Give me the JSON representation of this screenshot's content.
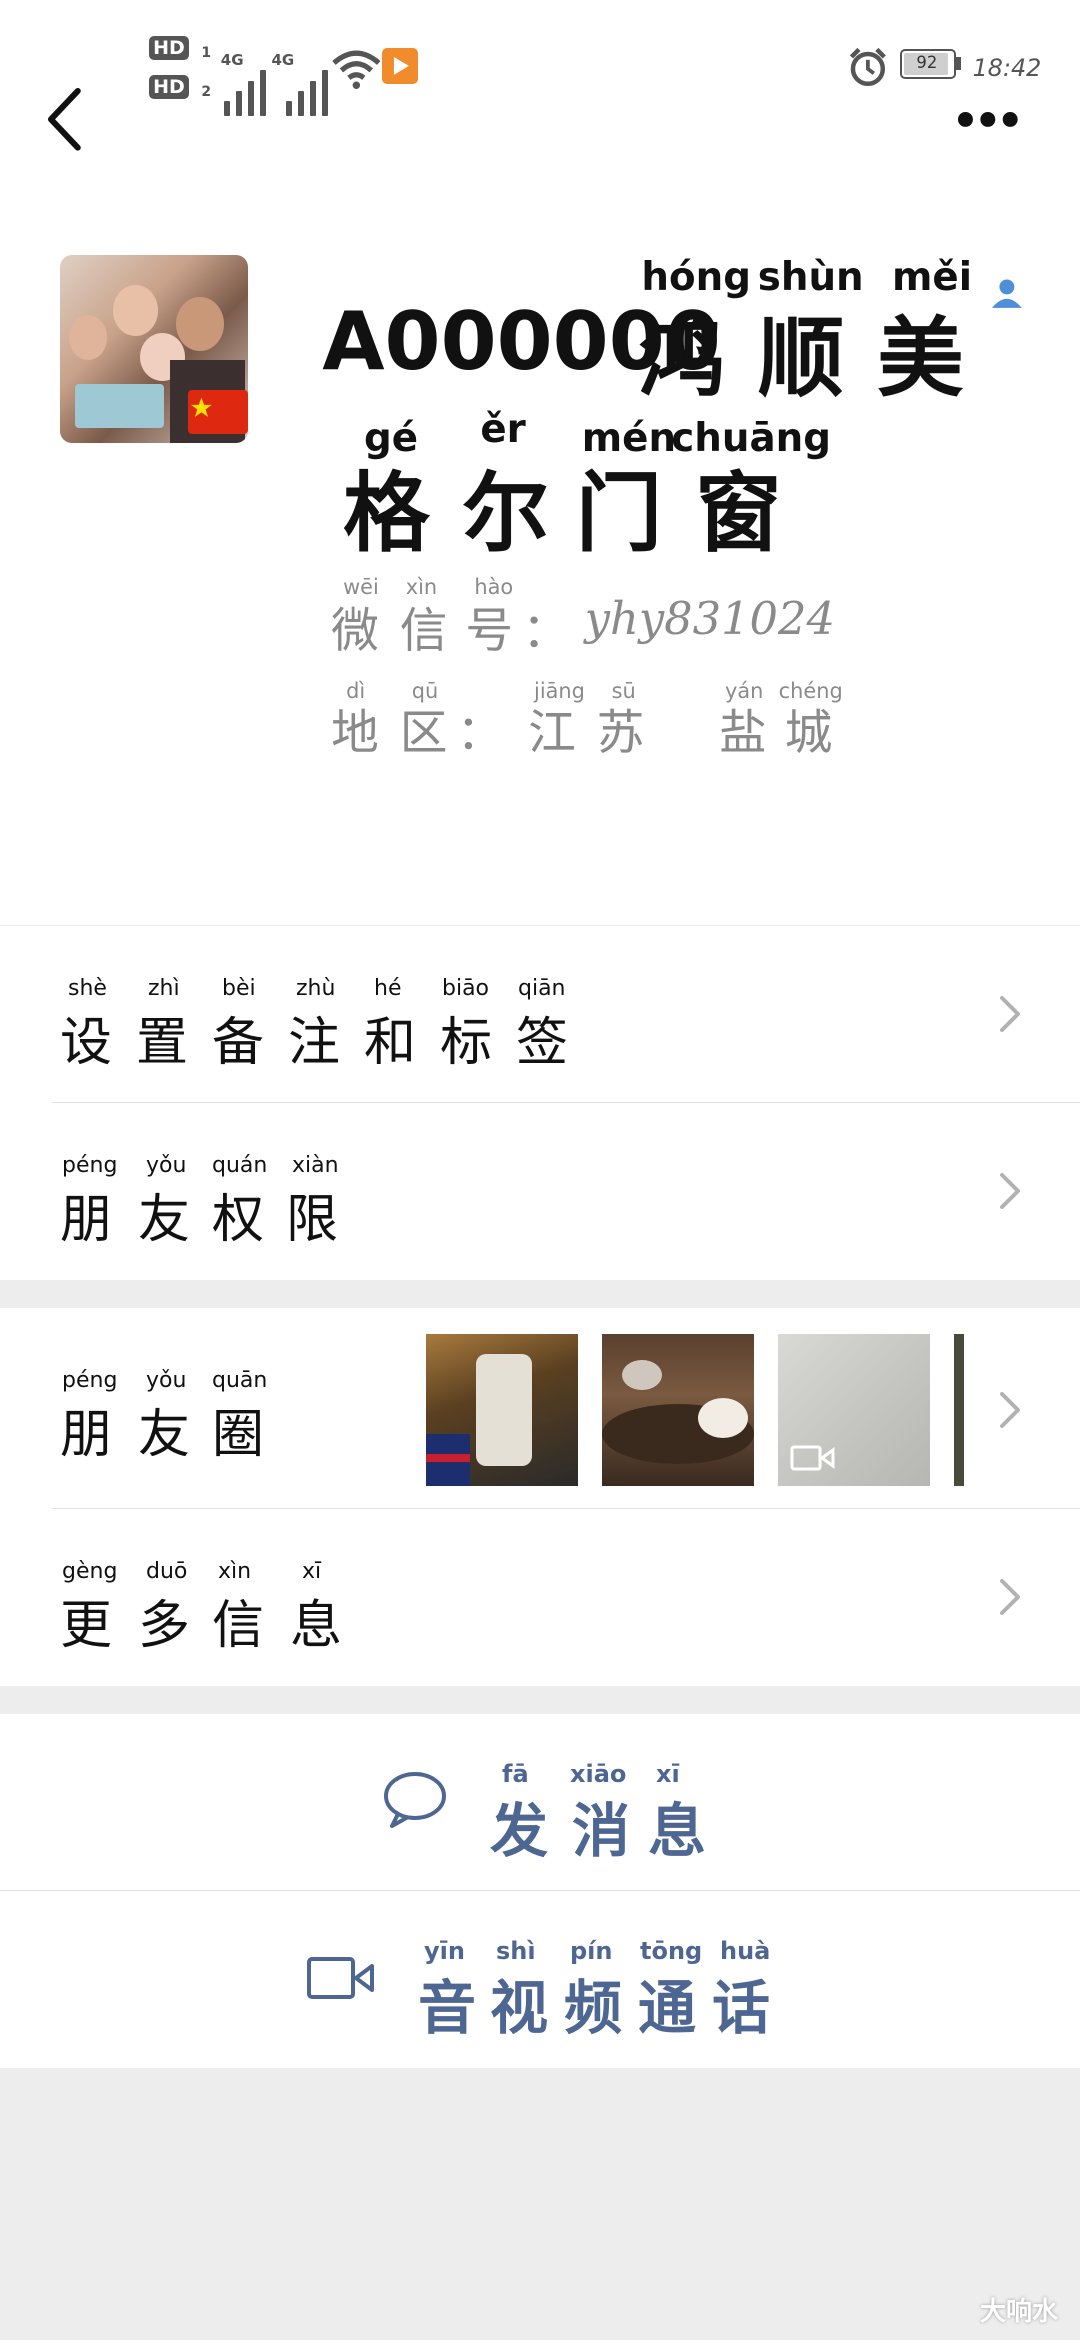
{
  "status_bar": {
    "hd1": "HD",
    "hd1_sub": "1",
    "hd2": "HD",
    "hd2_sub": "2",
    "net1": "4G",
    "net2": "4G",
    "battery_level": "92",
    "time": "18:42",
    "icons": [
      "signal-icon",
      "wifi-icon",
      "app-notification-icon",
      "alarm-icon",
      "battery-icon"
    ]
  },
  "nav": {
    "back_icon": "back-icon",
    "more_icon": "more-icon"
  },
  "profile": {
    "name_prefix": "A000000",
    "name_chars": [
      {
        "han": "鸿",
        "py": "hóng"
      },
      {
        "han": "顺",
        "py": "shùn"
      },
      {
        "han": "美",
        "py": "měi"
      }
    ],
    "name_chars_line2": [
      {
        "han": "格",
        "py": "gé"
      },
      {
        "han": "尔",
        "py": "ěr"
      },
      {
        "han": "门",
        "py": "mén"
      },
      {
        "han": "窗",
        "py": "chuāng"
      }
    ],
    "wechat_id_label": [
      {
        "han": "微",
        "py": "wēi"
      },
      {
        "han": "信",
        "py": "xìn"
      },
      {
        "han": "号",
        "py": "hào"
      }
    ],
    "wechat_id_colon": "：",
    "wechat_id": "yhy831024",
    "region_label": [
      {
        "han": "地",
        "py": "dì"
      },
      {
        "han": "区",
        "py": "qū"
      }
    ],
    "region_colon": "：",
    "region_value": [
      {
        "han": "江",
        "py": "jiāng"
      },
      {
        "han": "苏",
        "py": "sū"
      },
      {
        "han": "盐",
        "py": "yán"
      },
      {
        "han": "城",
        "py": "chéng"
      }
    ],
    "flag": "china-flag-icon"
  },
  "menu": {
    "remarks": [
      {
        "han": "设",
        "py": "shè"
      },
      {
        "han": "置",
        "py": "zhì"
      },
      {
        "han": "备",
        "py": "bèi"
      },
      {
        "han": "注",
        "py": "zhù"
      },
      {
        "han": "和",
        "py": "hé"
      },
      {
        "han": "标",
        "py": "biāo"
      },
      {
        "han": "签",
        "py": "qiān"
      }
    ],
    "permissions": [
      {
        "han": "朋",
        "py": "péng"
      },
      {
        "han": "友",
        "py": "yǒu"
      },
      {
        "han": "权",
        "py": "quán"
      },
      {
        "han": "限",
        "py": "xiàn"
      }
    ],
    "moments": [
      {
        "han": "朋",
        "py": "péng"
      },
      {
        "han": "友",
        "py": "yǒu"
      },
      {
        "han": "圈",
        "py": "quān"
      }
    ],
    "more_info": [
      {
        "han": "更",
        "py": "gèng"
      },
      {
        "han": "多",
        "py": "duō"
      },
      {
        "han": "信",
        "py": "xìn"
      },
      {
        "han": "息",
        "py": "xī"
      }
    ]
  },
  "actions": {
    "send_message": [
      {
        "han": "发",
        "py": "fā"
      },
      {
        "han": "消",
        "py": "xiāo"
      },
      {
        "han": "息",
        "py": "xī"
      }
    ],
    "video_call": [
      {
        "han": "音",
        "py": "yīn"
      },
      {
        "han": "视",
        "py": "shì"
      },
      {
        "han": "频",
        "py": "pín"
      },
      {
        "han": "通",
        "py": "tōng"
      },
      {
        "han": "话",
        "py": "huà"
      }
    ]
  },
  "watermark": "大响水",
  "colors": {
    "accent": "#4e6692",
    "background": "#ededed",
    "grey_text": "#8a8a8a"
  }
}
